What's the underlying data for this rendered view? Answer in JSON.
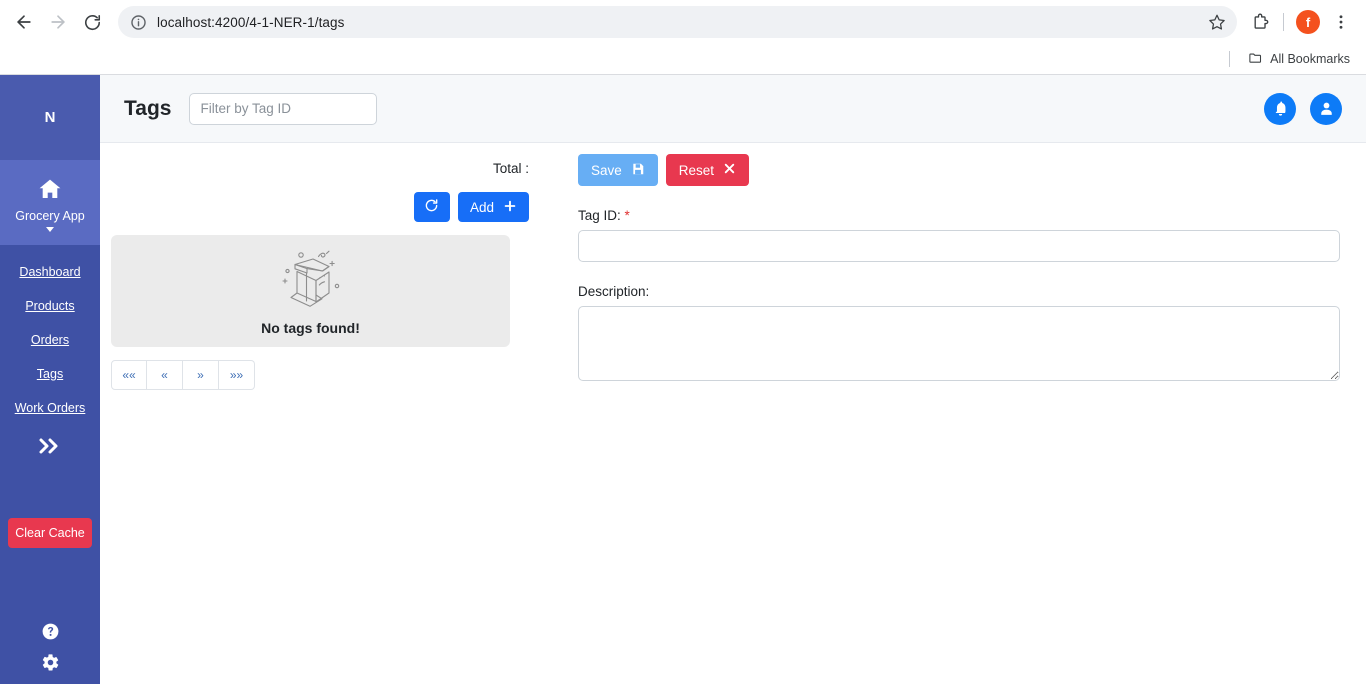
{
  "browser": {
    "url": "localhost:4200/4-1-NER-1/tags",
    "back_label": "Back",
    "forward_label": "Forward",
    "reload_label": "Reload",
    "site_info_label": "View site information",
    "bookmark_label": "Bookmark this tab",
    "extensions_label": "Extensions",
    "profile_initial": "f",
    "menu_label": "Customize and control Google Chrome",
    "bookmarks": {
      "all_bookmarks_label": "All Bookmarks"
    }
  },
  "sidebar": {
    "logo": "N",
    "app": {
      "label": "Grocery App"
    },
    "items": [
      {
        "label": "Dashboard"
      },
      {
        "label": "Products"
      },
      {
        "label": "Orders"
      },
      {
        "label": "Tags"
      },
      {
        "label": "Work Orders"
      }
    ],
    "expand_label": "»",
    "clear_cache_label": "Clear Cache",
    "help_label": "Help",
    "settings_label": "Settings"
  },
  "header": {
    "title": "Tags",
    "filter": {
      "value": "",
      "placeholder": "Filter by Tag ID"
    },
    "notifications_label": "Notifications",
    "account_label": "Account"
  },
  "list_panel": {
    "total_label": "Total :",
    "total_value": "",
    "refresh_label": "",
    "add_label": "Add",
    "empty_message": "No tags found!",
    "pagination": [
      {
        "label": "««",
        "name": "first-page"
      },
      {
        "label": "«",
        "name": "prev-page"
      },
      {
        "label": "»",
        "name": "next-page"
      },
      {
        "label": "»»",
        "name": "last-page"
      }
    ]
  },
  "form": {
    "save_label": "Save",
    "reset_label": "Reset",
    "tag_id": {
      "label": "Tag ID:",
      "required_mark": "*",
      "value": "",
      "placeholder": ""
    },
    "description": {
      "label": "Description:",
      "value": "",
      "placeholder": ""
    }
  },
  "colors": {
    "sidebar": "#3f51a5",
    "sidebar_active": "#5a6bc2",
    "primary": "#176ef7",
    "save": "#67aef4",
    "danger": "#e8384f",
    "header_bg": "#f6f8fa",
    "empty_bg": "#ebebeb"
  }
}
